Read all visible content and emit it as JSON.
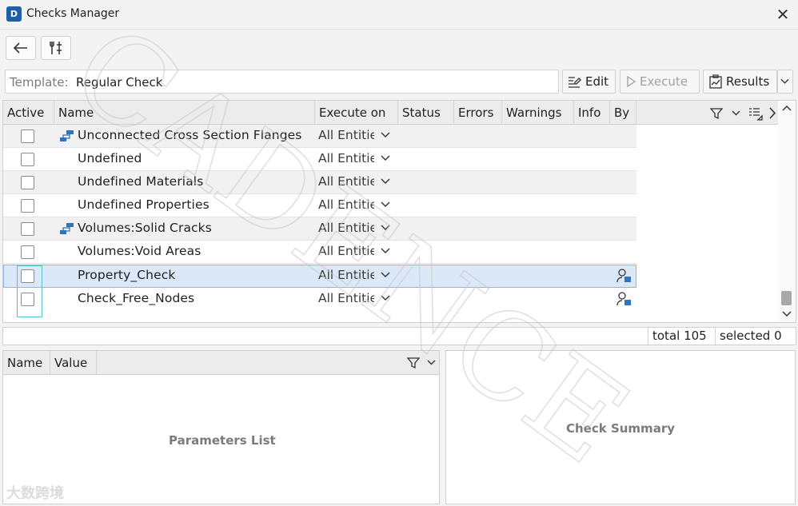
{
  "window": {
    "title": "Checks Manager",
    "app_icon": "app-logo-icon",
    "close_glyph": "✕"
  },
  "toolbar": {
    "back_icon": "arrow-left-icon",
    "settings_icon": "tools-icon"
  },
  "template": {
    "label": "Template:",
    "value": "Regular Check"
  },
  "actions": {
    "edit_label": "Edit",
    "execute_label": "Execute",
    "results_label": "Results"
  },
  "table": {
    "columns": [
      "Active",
      "Name",
      "Execute on",
      "Status",
      "Errors",
      "Warnings",
      "Info",
      "By"
    ],
    "rows": [
      {
        "name": "Unconnected Cross Section Flanges",
        "execute_on": "All Entities",
        "group": true,
        "by_icon": false
      },
      {
        "name": "Undefined",
        "execute_on": "All Entities",
        "group": false,
        "by_icon": false
      },
      {
        "name": "Undefined Materials",
        "execute_on": "All Entities",
        "group": false,
        "by_icon": false
      },
      {
        "name": "Undefined Properties",
        "execute_on": "All Entities",
        "group": false,
        "by_icon": false
      },
      {
        "name": "Volumes:Solid Cracks",
        "execute_on": "All Entities",
        "group": true,
        "by_icon": false
      },
      {
        "name": "Volumes:Void Areas",
        "execute_on": "All Entities",
        "group": false,
        "by_icon": false
      },
      {
        "name": "Property_Check",
        "execute_on": "All Entities",
        "group": false,
        "by_icon": true,
        "selected": true
      },
      {
        "name": "Check_Free_Nodes",
        "execute_on": "All Entities",
        "group": false,
        "by_icon": true
      }
    ]
  },
  "status": {
    "total": "total 105",
    "selected": "selected 0"
  },
  "parameters": {
    "columns": [
      "Name",
      "Value"
    ],
    "placeholder": "Parameters List"
  },
  "summary": {
    "placeholder": "Check Summary"
  },
  "watermark": {
    "text": "CADENCE",
    "bottom_text": "大数跨境"
  },
  "colors": {
    "accent": "#1f5fa6",
    "selection": "#dbe8f8",
    "focus": "#56c2cc"
  }
}
